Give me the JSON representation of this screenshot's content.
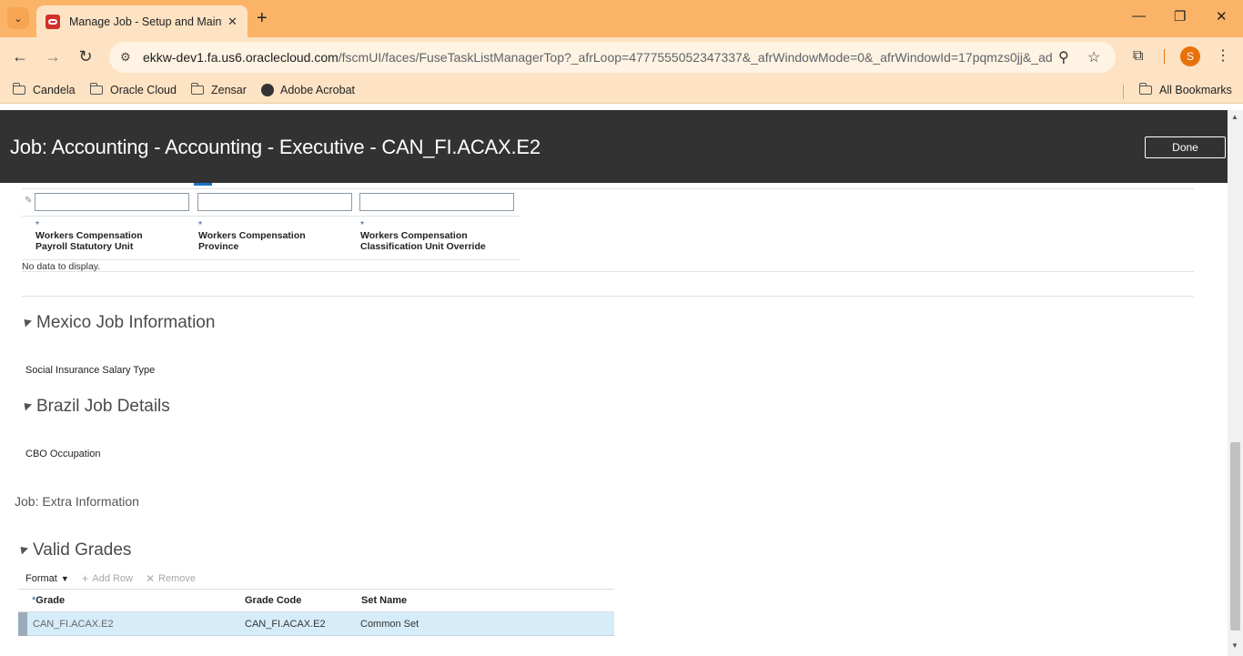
{
  "browser": {
    "tab_title": "Manage Job - Setup and Maint",
    "url_host": "ekkw-dev1.fa.us6.oraclecloud.com",
    "url_rest": "/fscmUI/faces/FuseTaskListManagerTop?_afrLoop=4777555052347337&_afrWindowMode=0&_afrWindowId=17pqmzs0jj&_ad...",
    "profile_initial": "S",
    "bookmarks": [
      "Candela",
      "Oracle Cloud",
      "Zensar",
      "Adobe Acrobat"
    ],
    "all_bookmarks": "All Bookmarks"
  },
  "header": {
    "title": "Job: Accounting - Accounting - Executive - CAN_FI.ACAX.E2",
    "done_label": "Done"
  },
  "workers_comp_table": {
    "columns": [
      {
        "req": "*",
        "label_line1": "Workers Compensation",
        "label_line2": "Payroll Statutory Unit"
      },
      {
        "req": "*",
        "label_line1": "Workers Compensation",
        "label_line2": "Province"
      },
      {
        "req": "*",
        "label_line1": "Workers Compensation",
        "label_line2": "Classification Unit Override"
      }
    ],
    "empty_text": "No data to display."
  },
  "mexico": {
    "title": "Mexico Job Information",
    "field_label": "Social Insurance Salary Type"
  },
  "brazil": {
    "title": "Brazil Job Details",
    "field_label": "CBO Occupation"
  },
  "extra_info": "Job: Extra Information",
  "valid_grades": {
    "title": "Valid Grades",
    "toolbar": {
      "format": "Format",
      "add_row": "Add Row",
      "remove": "Remove"
    },
    "columns": {
      "grade_req": "*",
      "grade": "Grade",
      "grade_code": "Grade Code",
      "set_name": "Set Name"
    },
    "rows": [
      {
        "grade": "CAN_FI.ACAX.E2",
        "grade_code": "CAN_FI.ACAX.E2",
        "set_name": "Common Set"
      }
    ]
  }
}
